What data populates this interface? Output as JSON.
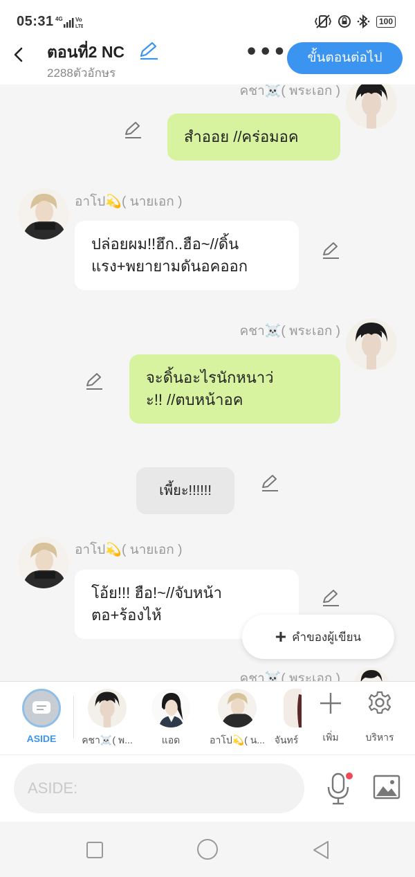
{
  "status": {
    "time": "05:31",
    "net_top": "⁴ᴳ",
    "volte": "Vo LTE",
    "battery": "100"
  },
  "header": {
    "title": "ตอนที่2 NC",
    "subtitle": "2288ตัวอักษร",
    "next_label": "ขั้นตอนต่อไป"
  },
  "messages": [
    {
      "name": "คชา☠️( พระเอก )",
      "text": "สำออย //คร่อมอค"
    },
    {
      "name": "อาโป💫( นายเอก )",
      "text": "ปล่อยผม!!ฮึก..ฮือ~//ดิ้น\nแรง+พยายามดันอคออก"
    },
    {
      "name": "คชา☠️( พระเอก )",
      "text": "จะดิ้นอะไรนักหนาว่\nะ!! //ตบหน้าอค"
    },
    {
      "name": "",
      "text": "เพี้ยะ!!!!!!"
    },
    {
      "name": "อาโป💫( นายเอก )",
      "text": "โอ้ย!!! ฮือ!~//จับหน้า\nตอ+ร้องไห้"
    },
    {
      "name": "คชา☠️( พระเอก )",
      "text": ""
    }
  ],
  "writer_button": "คำของผู้เขียน",
  "characters": [
    {
      "label": "ASIDE"
    },
    {
      "label": "คชา☠️( พ..."
    },
    {
      "label": "แอด"
    },
    {
      "label": "อาโป💫( น..."
    },
    {
      "label": "จันทร์"
    },
    {
      "label": "เพิ่ม"
    },
    {
      "label": "บริหาร"
    }
  ],
  "input": {
    "placeholder": "ASIDE:"
  },
  "colors": {
    "accent": "#3b95f0",
    "green_bubble": "#d7f3a0",
    "notification": "#f04a5a"
  }
}
